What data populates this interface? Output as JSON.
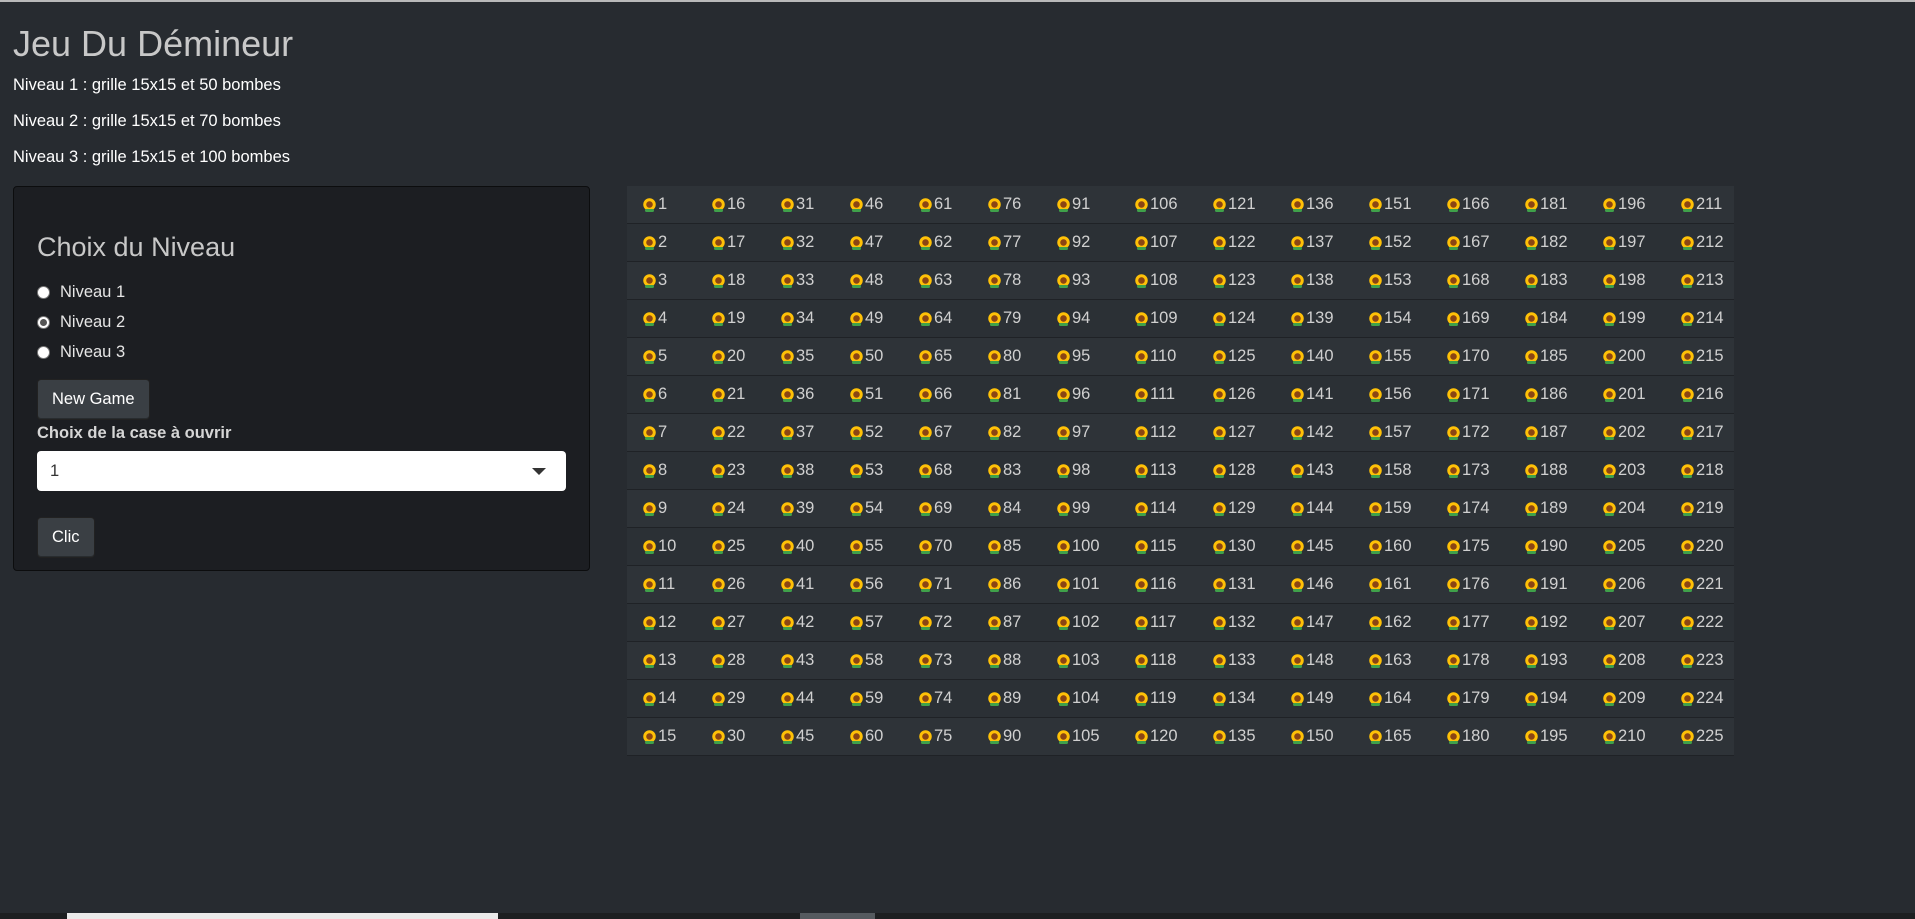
{
  "title": "Jeu Du Démineur",
  "levels_info": [
    "Niveau 1 : grille 15x15 et 50 bombes",
    "Niveau 2 : grille 15x15 et 70 bombes",
    "Niveau 3 : grille 15x15 et 100 bombes"
  ],
  "panel": {
    "heading": "Choix du Niveau",
    "radios": [
      {
        "label": "Niveau 1",
        "checked": false
      },
      {
        "label": "Niveau 2",
        "checked": true
      },
      {
        "label": "Niveau 3",
        "checked": false
      }
    ],
    "new_game_label": "New Game",
    "select_label": "Choix de la case à ouvrir",
    "select_value": "1",
    "clic_label": "Clic"
  },
  "grid": {
    "rows": 15,
    "cols": 15,
    "icon": "flower-icon",
    "cells": [
      [
        1,
        16,
        31,
        46,
        61,
        76,
        91,
        106,
        121,
        136,
        151,
        166,
        181,
        196,
        211
      ],
      [
        2,
        17,
        32,
        47,
        62,
        77,
        92,
        107,
        122,
        137,
        152,
        167,
        182,
        197,
        212
      ],
      [
        3,
        18,
        33,
        48,
        63,
        78,
        93,
        108,
        123,
        138,
        153,
        168,
        183,
        198,
        213
      ],
      [
        4,
        19,
        34,
        49,
        64,
        79,
        94,
        109,
        124,
        139,
        154,
        169,
        184,
        199,
        214
      ],
      [
        5,
        20,
        35,
        50,
        65,
        80,
        95,
        110,
        125,
        140,
        155,
        170,
        185,
        200,
        215
      ],
      [
        6,
        21,
        36,
        51,
        66,
        81,
        96,
        111,
        126,
        141,
        156,
        171,
        186,
        201,
        216
      ],
      [
        7,
        22,
        37,
        52,
        67,
        82,
        97,
        112,
        127,
        142,
        157,
        172,
        187,
        202,
        217
      ],
      [
        8,
        23,
        38,
        53,
        68,
        83,
        98,
        113,
        128,
        143,
        158,
        173,
        188,
        203,
        218
      ],
      [
        9,
        24,
        39,
        54,
        69,
        84,
        99,
        114,
        129,
        144,
        159,
        174,
        189,
        204,
        219
      ],
      [
        10,
        25,
        40,
        55,
        70,
        85,
        100,
        115,
        130,
        145,
        160,
        175,
        190,
        205,
        220
      ],
      [
        11,
        26,
        41,
        56,
        71,
        86,
        101,
        116,
        131,
        146,
        161,
        176,
        191,
        206,
        221
      ],
      [
        12,
        27,
        42,
        57,
        72,
        87,
        102,
        117,
        132,
        147,
        162,
        177,
        192,
        207,
        222
      ],
      [
        13,
        28,
        43,
        58,
        73,
        88,
        103,
        118,
        133,
        148,
        163,
        178,
        193,
        208,
        223
      ],
      [
        14,
        29,
        44,
        59,
        74,
        89,
        104,
        119,
        134,
        149,
        164,
        179,
        194,
        209,
        224
      ],
      [
        15,
        30,
        45,
        60,
        75,
        90,
        105,
        120,
        135,
        150,
        165,
        180,
        195,
        210,
        225
      ]
    ]
  }
}
